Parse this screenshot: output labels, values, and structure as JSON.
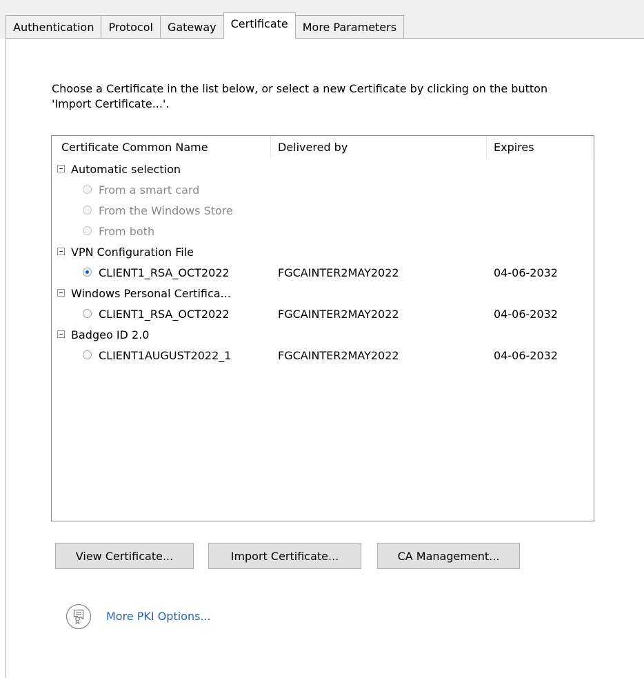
{
  "tabs": [
    {
      "label": "Authentication"
    },
    {
      "label": "Protocol"
    },
    {
      "label": "Gateway"
    },
    {
      "label": "Certificate"
    },
    {
      "label": "More Parameters"
    }
  ],
  "selected_tab": "Certificate",
  "instructions": "Choose a Certificate in the list below, or select a new Certificate by clicking on the button 'Import Certificate...'.",
  "list": {
    "columns": [
      "Certificate Common Name",
      "Delivered by",
      "Expires"
    ],
    "groups": [
      {
        "label": "Automatic selection",
        "items": [
          {
            "name": "From a smart card",
            "delivered_by": "",
            "expires": "",
            "checked": false,
            "disabled": true
          },
          {
            "name": "From the Windows Store",
            "delivered_by": "",
            "expires": "",
            "checked": false,
            "disabled": true
          },
          {
            "name": "From both",
            "delivered_by": "",
            "expires": "",
            "checked": false,
            "disabled": true
          }
        ]
      },
      {
        "label": "VPN Configuration File",
        "items": [
          {
            "name": "CLIENT1_RSA_OCT2022",
            "delivered_by": "FGCAINTER2MAY2022",
            "expires": "04-06-2032",
            "checked": true,
            "disabled": false
          }
        ]
      },
      {
        "label": "Windows Personal Certifica...",
        "items": [
          {
            "name": "CLIENT1_RSA_OCT2022",
            "delivered_by": "FGCAINTER2MAY2022",
            "expires": "04-06-2032",
            "checked": false,
            "disabled": false
          }
        ]
      },
      {
        "label": "Badgeo ID 2.0",
        "items": [
          {
            "name": "CLIENT1AUGUST2022_1",
            "delivered_by": "FGCAINTER2MAY2022",
            "expires": "04-06-2032",
            "checked": false,
            "disabled": false
          }
        ]
      }
    ]
  },
  "buttons": {
    "view": "View Certificate...",
    "import": "Import Certificate...",
    "ca": "CA Management..."
  },
  "more_pki": {
    "icon": "certificate-icon",
    "label": "More PKI Options..."
  },
  "colors": {
    "link": "#2461b5",
    "radio_checked": "#1a5fb4",
    "button_bg": "#e1e1e1"
  }
}
